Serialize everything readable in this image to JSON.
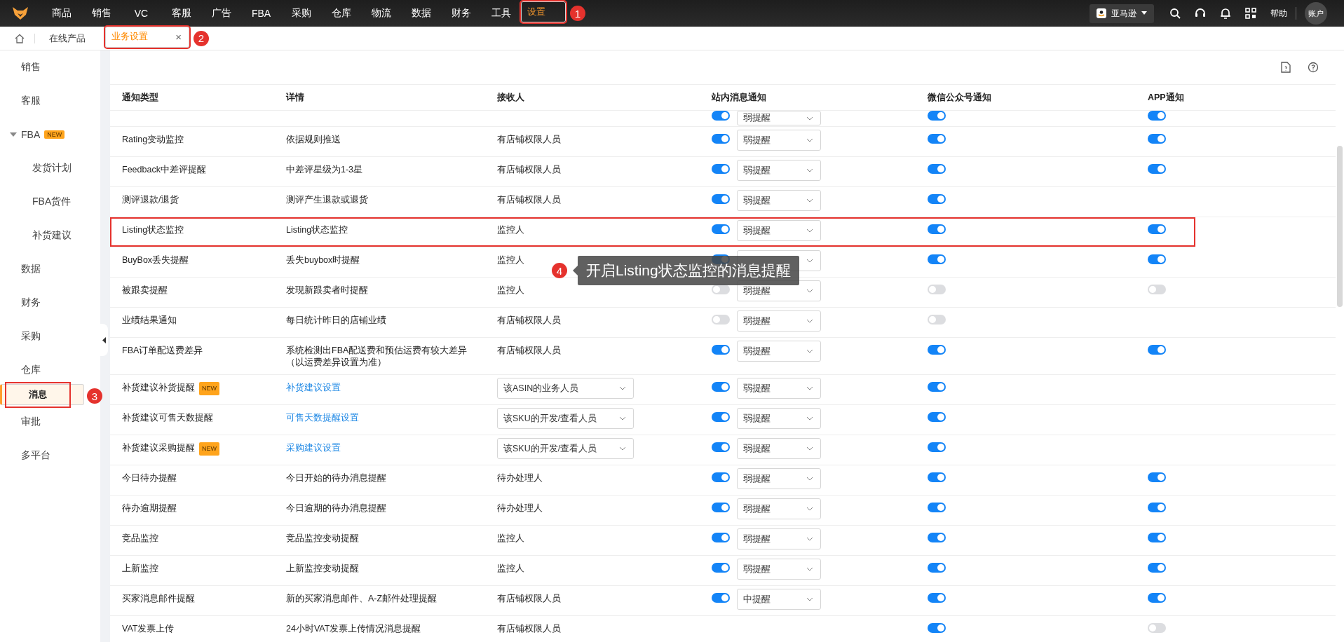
{
  "top_nav": {
    "items": [
      {
        "label": "商品",
        "selected": false,
        "highlighted": false
      },
      {
        "label": "销售",
        "selected": false,
        "highlighted": false
      },
      {
        "label": "VC",
        "selected": false,
        "highlighted": false
      },
      {
        "label": "客服",
        "selected": false,
        "highlighted": false
      },
      {
        "label": "广告",
        "selected": false,
        "highlighted": false
      },
      {
        "label": "FBA",
        "selected": false,
        "highlighted": false
      },
      {
        "label": "采购",
        "selected": false,
        "highlighted": false
      },
      {
        "label": "仓库",
        "selected": false,
        "highlighted": false
      },
      {
        "label": "物流",
        "selected": false,
        "highlighted": false
      },
      {
        "label": "数据",
        "selected": false,
        "highlighted": false
      },
      {
        "label": "财务",
        "selected": false,
        "highlighted": false
      },
      {
        "label": "工具",
        "selected": false,
        "highlighted": false
      },
      {
        "label": "设置",
        "selected": true,
        "highlighted": true,
        "marker": "1"
      }
    ],
    "platform": "亚马逊",
    "help": "帮助",
    "account": "账户"
  },
  "tabs": [
    {
      "label": "在线产品",
      "selected": false,
      "closable": false,
      "highlighted": false
    },
    {
      "label": "业务设置",
      "selected": true,
      "closable": true,
      "highlighted": true,
      "marker": "2"
    }
  ],
  "close_glyph": "×",
  "sidebar": {
    "items": [
      {
        "label": "销售",
        "selected": false,
        "highlighted": false
      },
      {
        "label": "客服",
        "selected": false,
        "highlighted": false
      },
      {
        "label": "FBA",
        "badge": "NEW",
        "expanded": true,
        "selected": false,
        "highlighted": false,
        "children": [
          {
            "label": "发货计划",
            "selected": false,
            "highlighted": false
          },
          {
            "label": "FBA货件",
            "selected": false,
            "highlighted": false
          },
          {
            "label": "补货建议",
            "selected": false,
            "highlighted": false
          }
        ]
      },
      {
        "label": "数据",
        "selected": false,
        "highlighted": false
      },
      {
        "label": "财务",
        "selected": false,
        "highlighted": false
      },
      {
        "label": "采购",
        "selected": false,
        "highlighted": false
      },
      {
        "label": "仓库",
        "selected": false,
        "highlighted": false
      },
      {
        "label": "消息",
        "selected": true,
        "highlighted": true,
        "marker": "3"
      },
      {
        "label": "审批",
        "selected": false,
        "highlighted": false
      },
      {
        "label": "多平台",
        "selected": false,
        "highlighted": false
      }
    ]
  },
  "table": {
    "columns": [
      "通知类型",
      "详情",
      "接收人",
      "站内消息通知",
      "微信公众号通知",
      "APP通知"
    ],
    "rows": [
      {
        "highlighted": false,
        "site": {
          "on": true,
          "level": "弱提醒"
        },
        "wechat": {
          "on": true
        },
        "app": {
          "on": true
        }
      },
      {
        "type": "Rating变动监控",
        "detail": "依据规则推送",
        "detail_link": false,
        "recipient": {
          "kind": "text",
          "value": "有店铺权限人员"
        },
        "highlighted": false,
        "site": {
          "on": true,
          "level": "弱提醒"
        },
        "wechat": {
          "on": true
        },
        "app": {
          "on": true
        }
      },
      {
        "type": "Feedback中差评提醒",
        "detail": "中差评星级为1-3星",
        "detail_link": false,
        "recipient": {
          "kind": "text",
          "value": "有店铺权限人员"
        },
        "highlighted": false,
        "site": {
          "on": true,
          "level": "弱提醒"
        },
        "wechat": {
          "on": true
        },
        "app": {
          "on": true
        }
      },
      {
        "type": "测评退款/退货",
        "detail": "测评产生退款或退货",
        "detail_link": false,
        "recipient": {
          "kind": "text",
          "value": "有店铺权限人员"
        },
        "highlighted": false,
        "site": {
          "on": true,
          "level": "弱提醒"
        },
        "wechat": {
          "on": true
        }
      },
      {
        "type": "Listing状态监控",
        "detail": "Listing状态监控",
        "detail_link": false,
        "recipient": {
          "kind": "text",
          "value": "监控人"
        },
        "highlighted": true,
        "site": {
          "on": true,
          "level": "弱提醒"
        },
        "wechat": {
          "on": true
        },
        "app": {
          "on": true
        }
      },
      {
        "type": "BuyBox丢失提醒",
        "detail": "丢失buybox时提醒",
        "detail_link": false,
        "recipient": {
          "kind": "text",
          "value": "监控人"
        },
        "highlighted": false,
        "site": {
          "on": true
        },
        "wechat": {
          "on": true
        },
        "app": {
          "on": true
        }
      },
      {
        "type": "被跟卖提醒",
        "detail": "发现新跟卖者时提醒",
        "detail_link": false,
        "recipient": {
          "kind": "text",
          "value": "监控人"
        },
        "highlighted": false,
        "site": {
          "on": false,
          "level": "弱提醒"
        },
        "wechat": {
          "on": false
        },
        "app": {
          "on": false
        }
      },
      {
        "type": "业绩结果通知",
        "detail": "每日统计昨日的店铺业绩",
        "detail_link": false,
        "recipient": {
          "kind": "text",
          "value": "有店铺权限人员"
        },
        "highlighted": false,
        "site": {
          "on": false,
          "level": "弱提醒"
        },
        "wechat": {
          "on": false
        }
      },
      {
        "type": "FBA订单配送费差异",
        "detail": "系统检测出FBA配送费和预估运费有较大差异（以运费差异设置为准）",
        "detail_link": false,
        "recipient": {
          "kind": "text",
          "value": "有店铺权限人员"
        },
        "highlighted": false,
        "site": {
          "on": true,
          "level": "弱提醒"
        },
        "wechat": {
          "on": true
        },
        "app": {
          "on": true
        }
      },
      {
        "type": "补货建议补货提醒",
        "badge": "NEW",
        "detail": "补货建议设置",
        "detail_link": true,
        "recipient": {
          "kind": "select",
          "value": "该ASIN的业务人员"
        },
        "highlighted": false,
        "site": {
          "on": true,
          "level": "弱提醒"
        },
        "wechat": {
          "on": true
        }
      },
      {
        "type": "补货建议可售天数提醒",
        "detail": "可售天数提醒设置",
        "detail_link": true,
        "recipient": {
          "kind": "select",
          "value": "该SKU的开发/查看人员"
        },
        "highlighted": false,
        "site": {
          "on": true,
          "level": "弱提醒"
        },
        "wechat": {
          "on": true
        }
      },
      {
        "type": "补货建议采购提醒",
        "badge": "NEW",
        "detail": "采购建议设置",
        "detail_link": true,
        "recipient": {
          "kind": "select",
          "value": "该SKU的开发/查看人员"
        },
        "highlighted": false,
        "site": {
          "on": true,
          "level": "弱提醒"
        },
        "wechat": {
          "on": true
        }
      },
      {
        "type": "今日待办提醒",
        "detail": "今日开始的待办消息提醒",
        "detail_link": false,
        "recipient": {
          "kind": "text",
          "value": "待办处理人"
        },
        "highlighted": false,
        "site": {
          "on": true,
          "level": "弱提醒"
        },
        "wechat": {
          "on": true
        },
        "app": {
          "on": true
        }
      },
      {
        "type": "待办逾期提醒",
        "detail": "今日逾期的待办消息提醒",
        "detail_link": false,
        "recipient": {
          "kind": "text",
          "value": "待办处理人"
        },
        "highlighted": false,
        "site": {
          "on": true,
          "level": "弱提醒"
        },
        "wechat": {
          "on": true
        },
        "app": {
          "on": true
        }
      },
      {
        "type": "竞品监控",
        "detail": "竞品监控变动提醒",
        "detail_link": false,
        "recipient": {
          "kind": "text",
          "value": "监控人"
        },
        "highlighted": false,
        "site": {
          "on": true,
          "level": "弱提醒"
        },
        "wechat": {
          "on": true
        },
        "app": {
          "on": true
        }
      },
      {
        "type": "上新监控",
        "detail": "上新监控变动提醒",
        "detail_link": false,
        "recipient": {
          "kind": "text",
          "value": "监控人"
        },
        "highlighted": false,
        "site": {
          "on": true,
          "level": "弱提醒"
        },
        "wechat": {
          "on": true
        },
        "app": {
          "on": true
        }
      },
      {
        "type": "买家消息邮件提醒",
        "detail": "新的买家消息邮件、A-Z邮件处理提醒",
        "detail_link": false,
        "recipient": {
          "kind": "text",
          "value": "有店铺权限人员"
        },
        "highlighted": false,
        "site": {
          "on": true,
          "level": "中提醒"
        },
        "wechat": {
          "on": true
        },
        "app": {
          "on": true
        }
      },
      {
        "type": "VAT发票上传",
        "detail": "24小时VAT发票上传情况消息提醒",
        "detail_link": false,
        "recipient": {
          "kind": "text",
          "value": "有店铺权限人员"
        },
        "highlighted": false,
        "wechat": {
          "on": true
        },
        "app": {
          "on": false
        }
      }
    ]
  },
  "callout": {
    "marker": "4",
    "text": "开启Listing状态监控的消息提醒"
  }
}
